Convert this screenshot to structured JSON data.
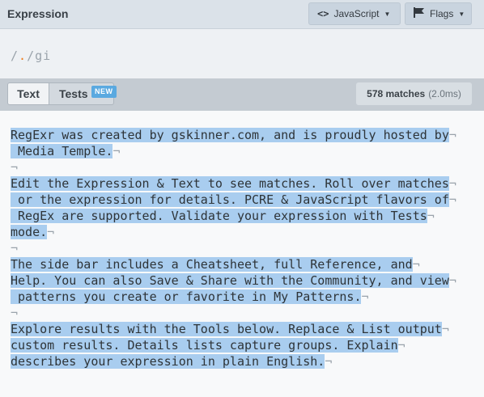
{
  "header": {
    "title": "Expression",
    "flavor_button": "JavaScript",
    "flags_button": "Flags"
  },
  "expression": {
    "open_delim": "/",
    "pattern": ".",
    "close_delim": "/",
    "flags": "gi"
  },
  "tabs": {
    "text": "Text",
    "tests": "Tests",
    "new_badge": "NEW"
  },
  "results": {
    "matches": "578 matches",
    "time": "(2.0ms)"
  },
  "text_lines": [
    "RegExr was created by gskinner.com, and is proudly hosted by",
    " Media Temple.",
    "",
    "Edit the Expression & Text to see matches. Roll over matches",
    " or the expression for details. PCRE & JavaScript flavors of",
    " RegEx are supported. Validate your expression with Tests",
    "mode.",
    "",
    "The side bar includes a Cheatsheet, full Reference, and",
    "Help. You can also Save & Share with the Community, and view",
    " patterns you create or favorite in My Patterns.",
    "",
    "Explore results with the Tools below. Replace & List output",
    "custom results. Details lists capture groups. Explain",
    "describes your expression in plain English."
  ],
  "colors": {
    "accent": "#5aa9e0",
    "highlight": "#a9cdef",
    "regex_dot": "#ef7a19"
  }
}
